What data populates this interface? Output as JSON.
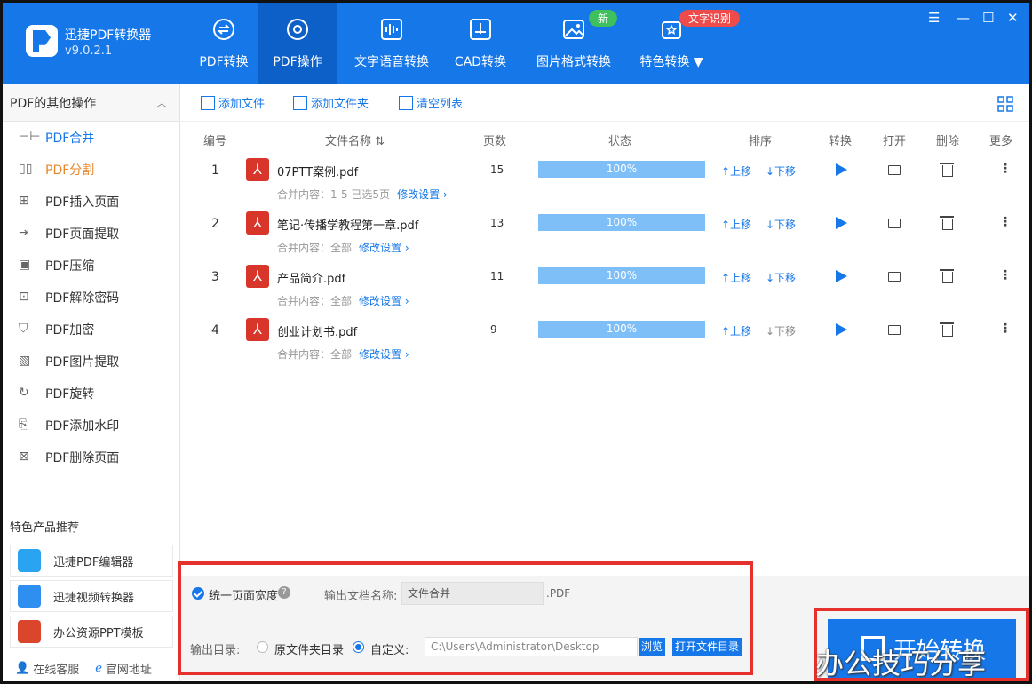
{
  "app": {
    "name": "迅捷PDF转换器",
    "version": "v9.0.2.1"
  },
  "nav": [
    {
      "label": "PDF转换",
      "icon": "pdf-convert-icon"
    },
    {
      "label": "PDF操作",
      "icon": "pdf-operate-icon",
      "active": true
    },
    {
      "label": "文字语音转换",
      "icon": "voice-wave-icon"
    },
    {
      "label": "CAD转换",
      "icon": "cad-icon"
    },
    {
      "label": "图片格式转换",
      "icon": "image-icon"
    },
    {
      "label": "特色转换",
      "icon": "special-convert-icon"
    }
  ],
  "badges": {
    "new": "新",
    "ocr": "文字识别"
  },
  "window": {
    "menu": "☰",
    "minimize": "—",
    "maximize": "☐",
    "close": "✕"
  },
  "sidebar": {
    "title": "PDF的其他操作",
    "items": [
      {
        "label": "PDF合并",
        "state": "active"
      },
      {
        "label": "PDF分割",
        "state": "orange"
      },
      {
        "label": "PDF插入页面"
      },
      {
        "label": "PDF页面提取"
      },
      {
        "label": "PDF压缩"
      },
      {
        "label": "PDF解除密码"
      },
      {
        "label": "PDF加密"
      },
      {
        "label": "PDF图片提取"
      },
      {
        "label": "PDF旋转"
      },
      {
        "label": "PDF添加水印"
      },
      {
        "label": "PDF删除页面"
      }
    ],
    "recommend_title": "特色产品推荐",
    "recommend": [
      {
        "label": "迅捷PDF编辑器",
        "color": "#2aa4f0"
      },
      {
        "label": "迅捷视频转换器",
        "color": "#2f8ff0"
      },
      {
        "label": "办公资源PPT模板",
        "color": "#d9462b"
      }
    ],
    "footer": {
      "service": "在线客服",
      "website": "官网地址"
    }
  },
  "toolbar": {
    "add_file": "添加文件",
    "add_folder": "添加文件夹",
    "clear": "清空列表"
  },
  "columns": {
    "num": "编号",
    "name": "文件名称",
    "sort_icon": "⇅",
    "pages": "页数",
    "status": "状态",
    "order": "排序",
    "convert": "转换",
    "open": "打开",
    "delete": "删除",
    "more": "更多"
  },
  "files": [
    {
      "num": "1",
      "name": "07PTT案例.pdf",
      "sub": "合并内容：1-5 已选5页",
      "link": "修改设置 ›",
      "pages": "15",
      "progress": "100%",
      "down_disabled": false
    },
    {
      "num": "2",
      "name": "笔记·传播学教程第一章.pdf",
      "sub": "合并内容：全部",
      "link": "修改设置 ›",
      "pages": "13",
      "progress": "100%",
      "down_disabled": false
    },
    {
      "num": "3",
      "name": "产品简介.pdf",
      "sub": "合并内容：全部",
      "link": "修改设置 ›",
      "pages": "11",
      "progress": "100%",
      "down_disabled": false
    },
    {
      "num": "4",
      "name": "创业计划书.pdf",
      "sub": "合并内容：全部",
      "link": "修改设置 ›",
      "pages": "9",
      "progress": "100%",
      "down_disabled": true
    }
  ],
  "order": {
    "up": "↑上移",
    "down": "↓下移"
  },
  "output": {
    "unify_width": "统一页面宽度",
    "help": "?",
    "name_label": "输出文档名称:",
    "name_value": "文件合并",
    "ext": ".PDF",
    "dir_label": "输出目录:",
    "opt_source": "原文件夹目录",
    "opt_custom": "自定义:",
    "path": "C:\\Users\\Administrator\\Desktop",
    "browse": "浏览",
    "open_dir": "打开文件目录"
  },
  "start_button": "开始转换",
  "watermark": "办公技巧分享",
  "colors": {
    "accent": "#1677e8",
    "highlight": "#e5312d",
    "pdf_red": "#d9362b"
  }
}
